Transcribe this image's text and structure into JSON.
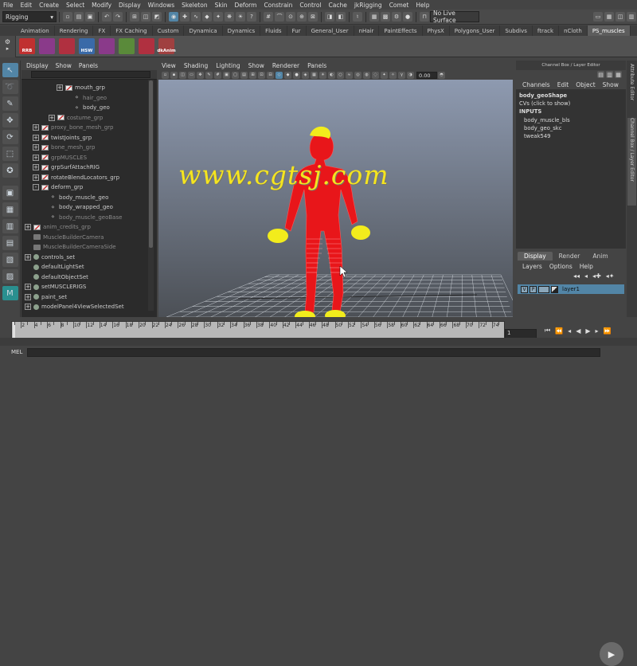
{
  "menubar": {
    "items": [
      "File",
      "Edit",
      "Create",
      "Select",
      "Modify",
      "Display",
      "Windows",
      "Skeleton",
      "Skin",
      "Deform",
      "Constrain",
      "Control",
      "Cache",
      "jkRigging",
      "Comet",
      "Help"
    ]
  },
  "statusline": {
    "mode": "Rigging",
    "live_surface": "No Live Surface"
  },
  "shelf": {
    "tabs": [
      "Animation",
      "Rendering",
      "FX",
      "FX Caching",
      "Custom",
      "Dynamica",
      "Dynamics",
      "Fluids",
      "Fur",
      "General_User",
      "nHair",
      "PaintEffects",
      "PhysX",
      "Polygons_User",
      "Subdivs",
      "ftrack",
      "nCloth",
      "PS_muscles"
    ],
    "active_tab": "PS_muscles",
    "buttons": [
      {
        "label": "RRB",
        "color": "#c03030"
      },
      {
        "label": "",
        "color": "#8a3a8a"
      },
      {
        "label": "",
        "color": "#b03040"
      },
      {
        "label": "HSW",
        "color": "#3a6aa8"
      },
      {
        "label": "",
        "color": "#8a3a8a"
      },
      {
        "label": "",
        "color": "#5a8a3a"
      },
      {
        "label": "",
        "color": "#b03040"
      },
      {
        "label": "dkAnim",
        "color": "#a04040"
      }
    ]
  },
  "outliner": {
    "menu": [
      "Display",
      "Show",
      "Panels"
    ],
    "rows": [
      {
        "label": "mouth_grp",
        "indent": 5,
        "expander": "+",
        "icon": "grp",
        "dim": false
      },
      {
        "label": "hair_geo",
        "indent": 6,
        "expander": "",
        "icon": "shp",
        "dim": true
      },
      {
        "label": "body_geo",
        "indent": 6,
        "expander": "",
        "icon": "shp",
        "dim": false
      },
      {
        "label": "costume_grp",
        "indent": 4,
        "expander": "+",
        "icon": "grp",
        "dim": true
      },
      {
        "label": "proxy_bone_mesh_grp",
        "indent": 2,
        "expander": "+",
        "icon": "grp",
        "dim": true
      },
      {
        "label": "twistJoints_grp",
        "indent": 2,
        "expander": "+",
        "icon": "grp",
        "dim": false
      },
      {
        "label": "bone_mesh_grp",
        "indent": 2,
        "expander": "+",
        "icon": "grp",
        "dim": true
      },
      {
        "label": "grpMUSCLES",
        "indent": 2,
        "expander": "+",
        "icon": "grp",
        "dim": true
      },
      {
        "label": "grpSurfAttachRIG",
        "indent": 2,
        "expander": "+",
        "icon": "grp",
        "dim": false
      },
      {
        "label": "rotateBlendLocators_grp",
        "indent": 2,
        "expander": "+",
        "icon": "grp",
        "dim": false
      },
      {
        "label": "deform_grp",
        "indent": 2,
        "expander": "-",
        "icon": "grp",
        "dim": false
      },
      {
        "label": "body_muscle_geo",
        "indent": 3,
        "expander": "",
        "icon": "shp",
        "dim": false
      },
      {
        "label": "body_wrapped_geo",
        "indent": 3,
        "expander": "",
        "icon": "shp",
        "dim": false
      },
      {
        "label": "body_muscle_geoBase",
        "indent": 3,
        "expander": "",
        "icon": "shp",
        "dim": true
      },
      {
        "label": "anim_credits_grp",
        "indent": 1,
        "expander": "+",
        "icon": "grp",
        "dim": true
      },
      {
        "label": "MuscleBuilderCamera",
        "indent": 1,
        "expander": "",
        "icon": "cam",
        "dim": true
      },
      {
        "label": "MuscleBuilderCameraSide",
        "indent": 1,
        "expander": "",
        "icon": "cam",
        "dim": true
      },
      {
        "label": "controls_set",
        "indent": 1,
        "expander": "+",
        "icon": "set",
        "dim": false
      },
      {
        "label": "defaultLightSet",
        "indent": 1,
        "expander": "",
        "icon": "set",
        "dim": false
      },
      {
        "label": "defaultObjectSet",
        "indent": 1,
        "expander": "",
        "icon": "set",
        "dim": false
      },
      {
        "label": "setMUSCLERIGS",
        "indent": 1,
        "expander": "+",
        "icon": "set",
        "dim": false
      },
      {
        "label": "paint_set",
        "indent": 1,
        "expander": "+",
        "icon": "set",
        "dim": false
      },
      {
        "label": "modelPanel4ViewSelectedSet",
        "indent": 1,
        "expander": "+",
        "icon": "set",
        "dim": false
      }
    ]
  },
  "viewport": {
    "menu": [
      "View",
      "Shading",
      "Lighting",
      "Show",
      "Renderer",
      "Panels"
    ],
    "field_value": "0.00",
    "watermark": "www.cgtsj.com",
    "body_color": "#e8161a",
    "hands_color": "#f2ec1c"
  },
  "channelbox": {
    "title": "Channel Box / Layer Editor",
    "menu": [
      "Channels",
      "Edit",
      "Object",
      "Show"
    ],
    "shape_name": "body_geoShape",
    "cvs_label": "CVs (click to show)",
    "inputs_label": "INPUTS",
    "inputs": [
      "body_muscle_bls",
      "body_geo_skc",
      "tweak549"
    ]
  },
  "layers": {
    "tabs": [
      "Display",
      "Render",
      "Anim"
    ],
    "active_tab": "Display",
    "menu": [
      "Layers",
      "Options",
      "Help"
    ],
    "layer_v": "V",
    "layer_p": "P",
    "layer_name": "layer1"
  },
  "sidetabs": [
    "Attribute Editor",
    "Channel Box / Layer Editor"
  ],
  "timeline": {
    "start": 1,
    "end": 75,
    "step": 2,
    "current_frame": "1"
  },
  "cmdline": {
    "label": "MEL"
  }
}
